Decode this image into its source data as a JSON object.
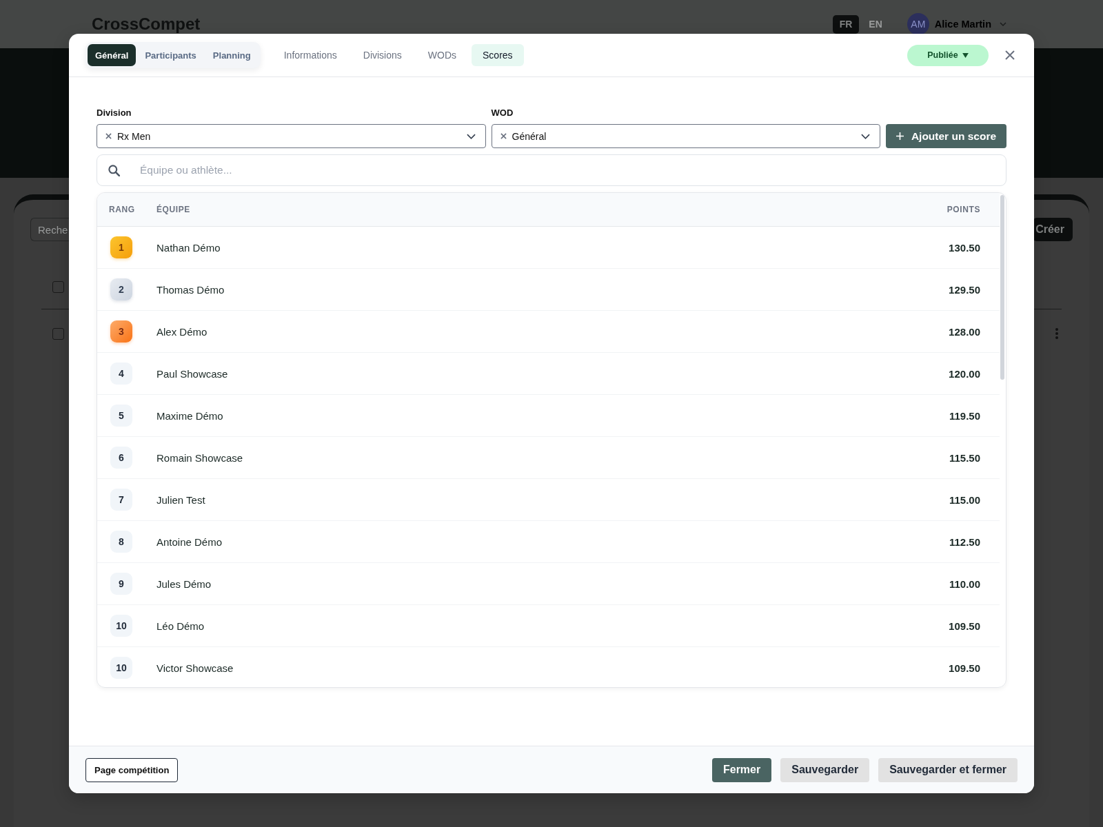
{
  "app_header": {
    "brand": "CrossCompet",
    "languages": [
      {
        "label": "FR",
        "selected": true
      },
      {
        "label": "EN",
        "selected": false
      }
    ],
    "user": {
      "initials": "AM",
      "name": "Alice Martin"
    }
  },
  "background_page": {
    "search_placeholder": "Reche",
    "create_button": "Créer",
    "checkboxes": [
      {
        "checked": false
      },
      {
        "checked": false
      }
    ]
  },
  "modal": {
    "view_tabs": [
      {
        "label": "Général",
        "selected": true
      },
      {
        "label": "Participants",
        "selected": false
      },
      {
        "label": "Planning",
        "selected": false
      }
    ],
    "section_tabs": [
      {
        "label": "Informations",
        "selected": false
      },
      {
        "label": "Divisions",
        "selected": false
      },
      {
        "label": "WODs",
        "selected": false
      },
      {
        "label": "Scores",
        "selected": true
      }
    ],
    "status": {
      "label": "Publiée"
    },
    "filters": [
      {
        "label": "Division",
        "value": "Rx Men"
      },
      {
        "label": "WOD",
        "value": "Général"
      }
    ],
    "add_button": "Ajouter un score",
    "search": {
      "placeholder": "Équipe ou athlète..."
    },
    "table": {
      "columns": [
        "RANG",
        "ÉQUIPE",
        "POINTS"
      ],
      "rows": [
        {
          "rank": "1",
          "team": "Nathan Démo",
          "points": "130.50",
          "kind": "gold"
        },
        {
          "rank": "2",
          "team": "Thomas Démo",
          "points": "129.50",
          "kind": "silver"
        },
        {
          "rank": "3",
          "team": "Alex Démo",
          "points": "128.00",
          "kind": "bronze"
        },
        {
          "rank": "4",
          "team": "Paul Showcase",
          "points": "120.00",
          "kind": "plain"
        },
        {
          "rank": "5",
          "team": "Maxime Démo",
          "points": "119.50",
          "kind": "plain"
        },
        {
          "rank": "6",
          "team": "Romain Showcase",
          "points": "115.50",
          "kind": "plain"
        },
        {
          "rank": "7",
          "team": "Julien Test",
          "points": "115.00",
          "kind": "plain"
        },
        {
          "rank": "8",
          "team": "Antoine Démo",
          "points": "112.50",
          "kind": "plain"
        },
        {
          "rank": "9",
          "team": "Jules Démo",
          "points": "110.00",
          "kind": "plain"
        },
        {
          "rank": "10",
          "team": "Léo Démo",
          "points": "109.50",
          "kind": "plain"
        },
        {
          "rank": "10",
          "team": "Victor Showcase",
          "points": "109.50",
          "kind": "plain"
        }
      ]
    },
    "footer": {
      "page_button": "Page compétition",
      "buttons": [
        {
          "label": "Fermer",
          "kind": "primary"
        },
        {
          "label": "Sauvegarder",
          "kind": "secondary"
        },
        {
          "label": "Sauvegarder et fermer",
          "kind": "secondary"
        }
      ]
    }
  }
}
